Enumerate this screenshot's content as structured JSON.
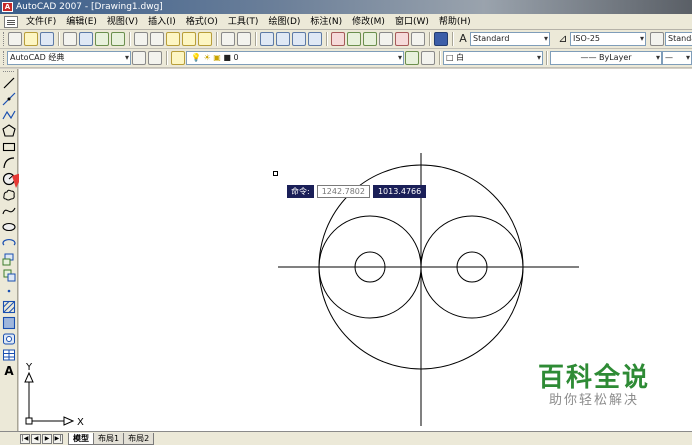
{
  "window": {
    "title": "AutoCAD 2007 - [Drawing1.dwg]",
    "app_icon": "A"
  },
  "menu": {
    "items": [
      "文件(F)",
      "编辑(E)",
      "视图(V)",
      "插入(I)",
      "格式(O)",
      "工具(T)",
      "绘图(D)",
      "标注(N)",
      "修改(M)",
      "窗口(W)",
      "帮助(H)"
    ]
  },
  "toolbar": {
    "text_style": "Standard",
    "dim_style": "ISO-25",
    "table_style": "Standard",
    "workspace": "AutoCAD 经典",
    "layer": "0",
    "color": "白",
    "linetype": "ByLayer"
  },
  "command_tip": {
    "label": "命令:",
    "x_value": "1242.7802",
    "y_value": "1013.4766"
  },
  "ucs": {
    "x_label": "X",
    "y_label": "Y"
  },
  "layout_tabs": {
    "tabs": [
      "模型",
      "布局1",
      "布局2"
    ],
    "nav": [
      "|◀",
      "◀",
      "▶",
      "▶|"
    ]
  },
  "watermark": {
    "main": "百科全说",
    "sub": "助你轻松解决"
  },
  "colors": {
    "command_tip_bg": "#1a1f58",
    "watermark_green": "#2e8b35",
    "arrow_red": "#e53935"
  }
}
